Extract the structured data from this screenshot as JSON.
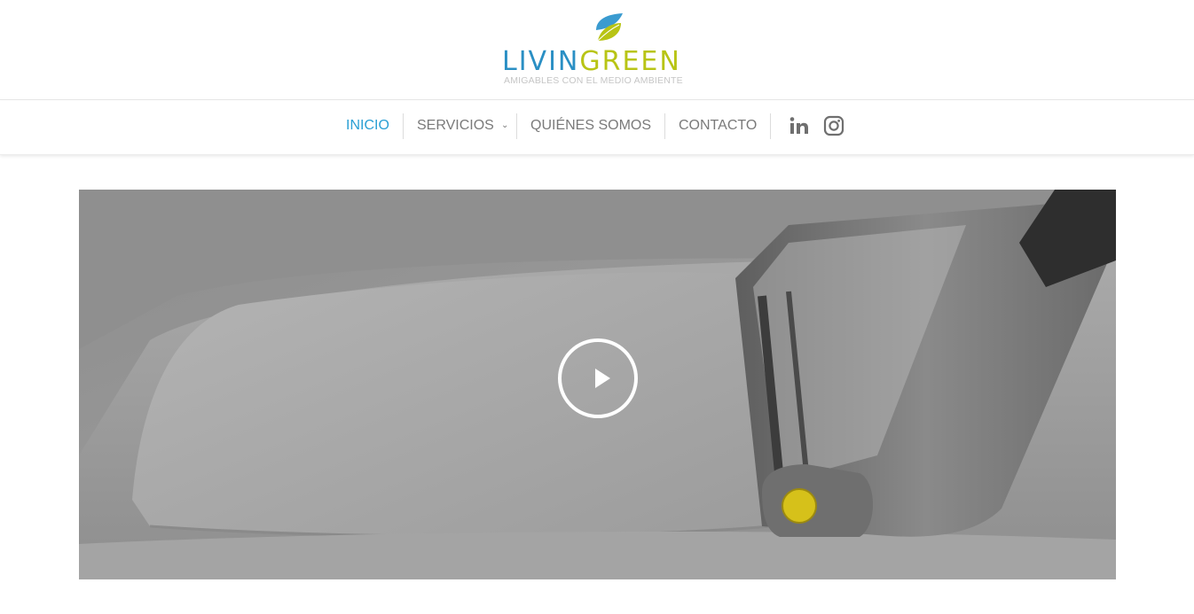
{
  "brand": {
    "name_part1": "LIVIN",
    "name_part2": "GREEN",
    "tagline": "AMIGABLES CON EL MEDIO AMBIENTE",
    "colors": {
      "blue": "#2a8fc4",
      "green": "#b8c415",
      "tagline": "#c6c6c6"
    }
  },
  "nav": {
    "items": [
      {
        "label": "INICIO",
        "active": true
      },
      {
        "label": "SERVICIOS",
        "has_dropdown": true
      },
      {
        "label": "QUIÉNES SOMOS"
      },
      {
        "label": "CONTACTO"
      }
    ],
    "social": [
      "linkedin-icon",
      "instagram-icon"
    ],
    "colors": {
      "active": "#2a9fd4",
      "default": "#7a7a7a"
    }
  },
  "hero": {
    "media": "video",
    "play_icon": "play-icon"
  }
}
